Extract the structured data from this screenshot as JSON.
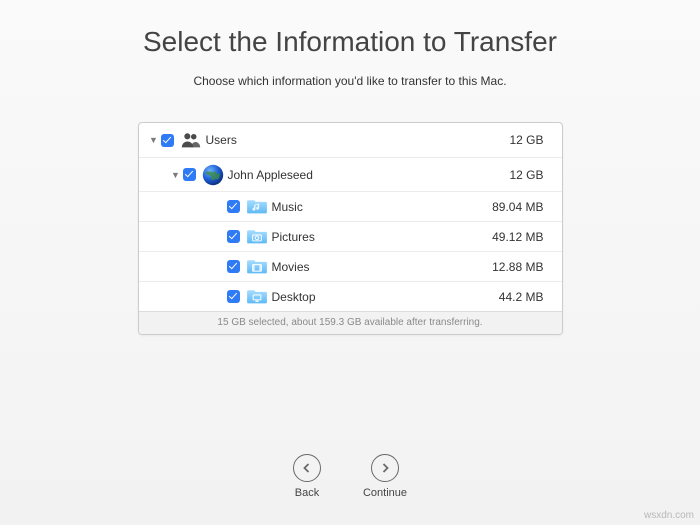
{
  "title": "Select the Information to Transfer",
  "subtitle": "Choose which information you'd like to transfer to this Mac.",
  "tree": {
    "users": {
      "label": "Users",
      "size": "12 GB"
    },
    "user0": {
      "label": "John Appleseed",
      "size": "12 GB"
    },
    "folders": [
      {
        "label": "Music",
        "size": "89.04 MB",
        "icon": "music"
      },
      {
        "label": "Pictures",
        "size": "49.12 MB",
        "icon": "pictures"
      },
      {
        "label": "Movies",
        "size": "12.88 MB",
        "icon": "movies"
      },
      {
        "label": "Desktop",
        "size": "44.2 MB",
        "icon": "desktop"
      }
    ]
  },
  "summary": "15 GB selected, about 159.3 GB available after transferring.",
  "nav": {
    "back": "Back",
    "continue": "Continue"
  },
  "watermark": "wsxdn.com"
}
